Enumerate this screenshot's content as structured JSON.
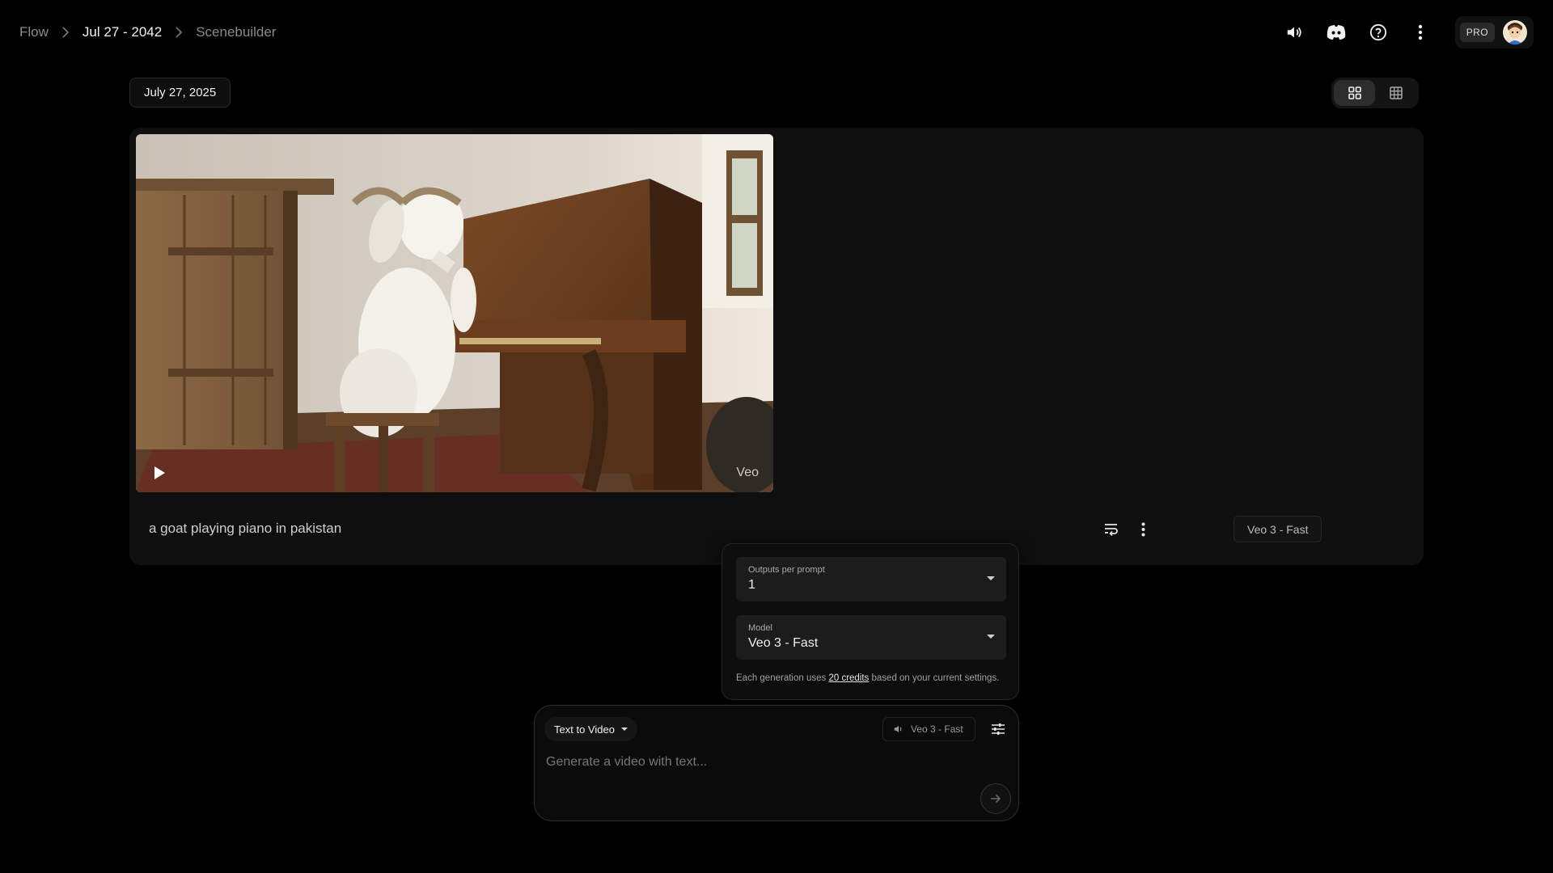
{
  "breadcrumb": {
    "root": "Flow",
    "project": "Jul 27 - 2042",
    "current": "Scenebuilder"
  },
  "header": {
    "icons": [
      "volume-icon",
      "discord-icon",
      "help-icon",
      "more-vert-icon"
    ],
    "plan_badge": "PRO"
  },
  "date_chip": "July 27, 2025",
  "view_toggle": {
    "options": [
      "grid-view-icon",
      "table-view-icon"
    ],
    "selected": "grid-view-icon"
  },
  "card": {
    "prompt": "a goat playing piano in pakistan",
    "watermark": "Veo",
    "model_label": "Veo 3 - Fast"
  },
  "settings": {
    "outputs": {
      "label": "Outputs per prompt",
      "value": "1"
    },
    "model": {
      "label": "Model",
      "value": "Veo 3 - Fast"
    },
    "credits_before": "Each generation uses ",
    "credits_link": "20 credits",
    "credits_after": " based on your current settings."
  },
  "composer": {
    "mode": "Text to Video",
    "model": "Veo 3 - Fast",
    "placeholder": "Generate a video with text..."
  },
  "colors": {
    "background": "#000000",
    "card": "#0f0f0f",
    "panel": "#1c1c1c"
  }
}
